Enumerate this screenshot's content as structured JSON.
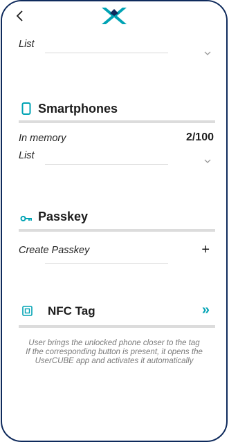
{
  "colors": {
    "accent": "#00a3b4",
    "frame": "#0e2a5c",
    "text": "#1d1d1d",
    "muted": "#7a7a7a",
    "divider": "#dcdcdc"
  },
  "header": {
    "back_icon": "chevron-left-icon",
    "logo_icon": "usercube-logo-icon"
  },
  "top_list": {
    "label": "List"
  },
  "smartphones": {
    "icon": "smartphone-icon",
    "title": "Smartphones",
    "in_memory_label": "In memory",
    "in_memory_value": "2/100",
    "list_label": "List"
  },
  "passkey": {
    "icon": "key-icon",
    "title": "Passkey",
    "create_label": "Create Passkey",
    "create_action": "+"
  },
  "nfc": {
    "icon": "nfc-tag-icon",
    "title": "NFC Tag",
    "action_icon": "double-chevron-right-icon",
    "action_glyph": "»",
    "desc_line1": "User brings the unlocked phone closer to the tag",
    "desc_line2": "If the corresponding button is present, it opens the",
    "desc_line3": "UserCUBE app and activates it automatically"
  }
}
